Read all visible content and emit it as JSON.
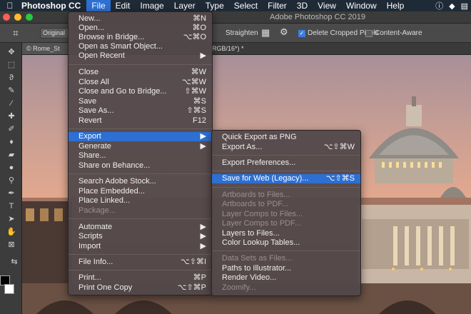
{
  "menubar": {
    "app": "Photoshop CC",
    "items": [
      "File",
      "Edit",
      "Image",
      "Layer",
      "Type",
      "Select",
      "Filter",
      "3D",
      "View",
      "Window",
      "Help"
    ]
  },
  "titlebar": {
    "title": "Adobe Photoshop CC 2019"
  },
  "options": {
    "ratio": "Original R",
    "straighten": "Straighten",
    "delete_cropped": "Delete Cropped Pixels",
    "content_aware": "Content-Aware"
  },
  "doc": {
    "tab_label": "© Rome_St",
    "tab_suffix": "RGB/16*) *"
  },
  "file_menu": [
    {
      "label": "New...",
      "sc": "⌘N"
    },
    {
      "label": "Open...",
      "sc": "⌘O"
    },
    {
      "label": "Browse in Bridge...",
      "sc": "⌥⌘O"
    },
    {
      "label": "Open as Smart Object...",
      "sc": ""
    },
    {
      "label": "Open Recent",
      "sc": "▶"
    },
    {
      "label": "Close",
      "sc": "⌘W"
    },
    {
      "label": "Close All",
      "sc": "⌥⌘W"
    },
    {
      "label": "Close and Go to Bridge...",
      "sc": "⇧⌘W"
    },
    {
      "label": "Save",
      "sc": "⌘S"
    },
    {
      "label": "Save As...",
      "sc": "⇧⌘S"
    },
    {
      "label": "Revert",
      "sc": "F12"
    },
    {
      "label": "Export",
      "sc": "▶"
    },
    {
      "label": "Generate",
      "sc": "▶"
    },
    {
      "label": "Share...",
      "sc": ""
    },
    {
      "label": "Share on Behance...",
      "sc": ""
    },
    {
      "label": "Search Adobe Stock...",
      "sc": ""
    },
    {
      "label": "Place Embedded...",
      "sc": ""
    },
    {
      "label": "Place Linked...",
      "sc": ""
    },
    {
      "label": "Package...",
      "sc": ""
    },
    {
      "label": "Automate",
      "sc": "▶"
    },
    {
      "label": "Scripts",
      "sc": "▶"
    },
    {
      "label": "Import",
      "sc": "▶"
    },
    {
      "label": "File Info...",
      "sc": "⌥⇧⌘I"
    },
    {
      "label": "Print...",
      "sc": "⌘P"
    },
    {
      "label": "Print One Copy",
      "sc": "⌥⇧⌘P"
    }
  ],
  "export_menu": [
    {
      "label": "Quick Export as PNG",
      "sc": ""
    },
    {
      "label": "Export As...",
      "sc": "⌥⇧⌘W"
    },
    {
      "label": "Export Preferences...",
      "sc": ""
    },
    {
      "label": "Save for Web (Legacy)...",
      "sc": "⌥⇧⌘S"
    },
    {
      "label": "Artboards to Files...",
      "sc": ""
    },
    {
      "label": "Artboards to PDF...",
      "sc": ""
    },
    {
      "label": "Layer Comps to Files...",
      "sc": ""
    },
    {
      "label": "Layer Comps to PDF...",
      "sc": ""
    },
    {
      "label": "Layers to Files...",
      "sc": ""
    },
    {
      "label": "Color Lookup Tables...",
      "sc": ""
    },
    {
      "label": "Data Sets as Files...",
      "sc": ""
    },
    {
      "label": "Paths to Illustrator...",
      "sc": ""
    },
    {
      "label": "Render Video...",
      "sc": ""
    },
    {
      "label": "Zoomify...",
      "sc": ""
    }
  ]
}
